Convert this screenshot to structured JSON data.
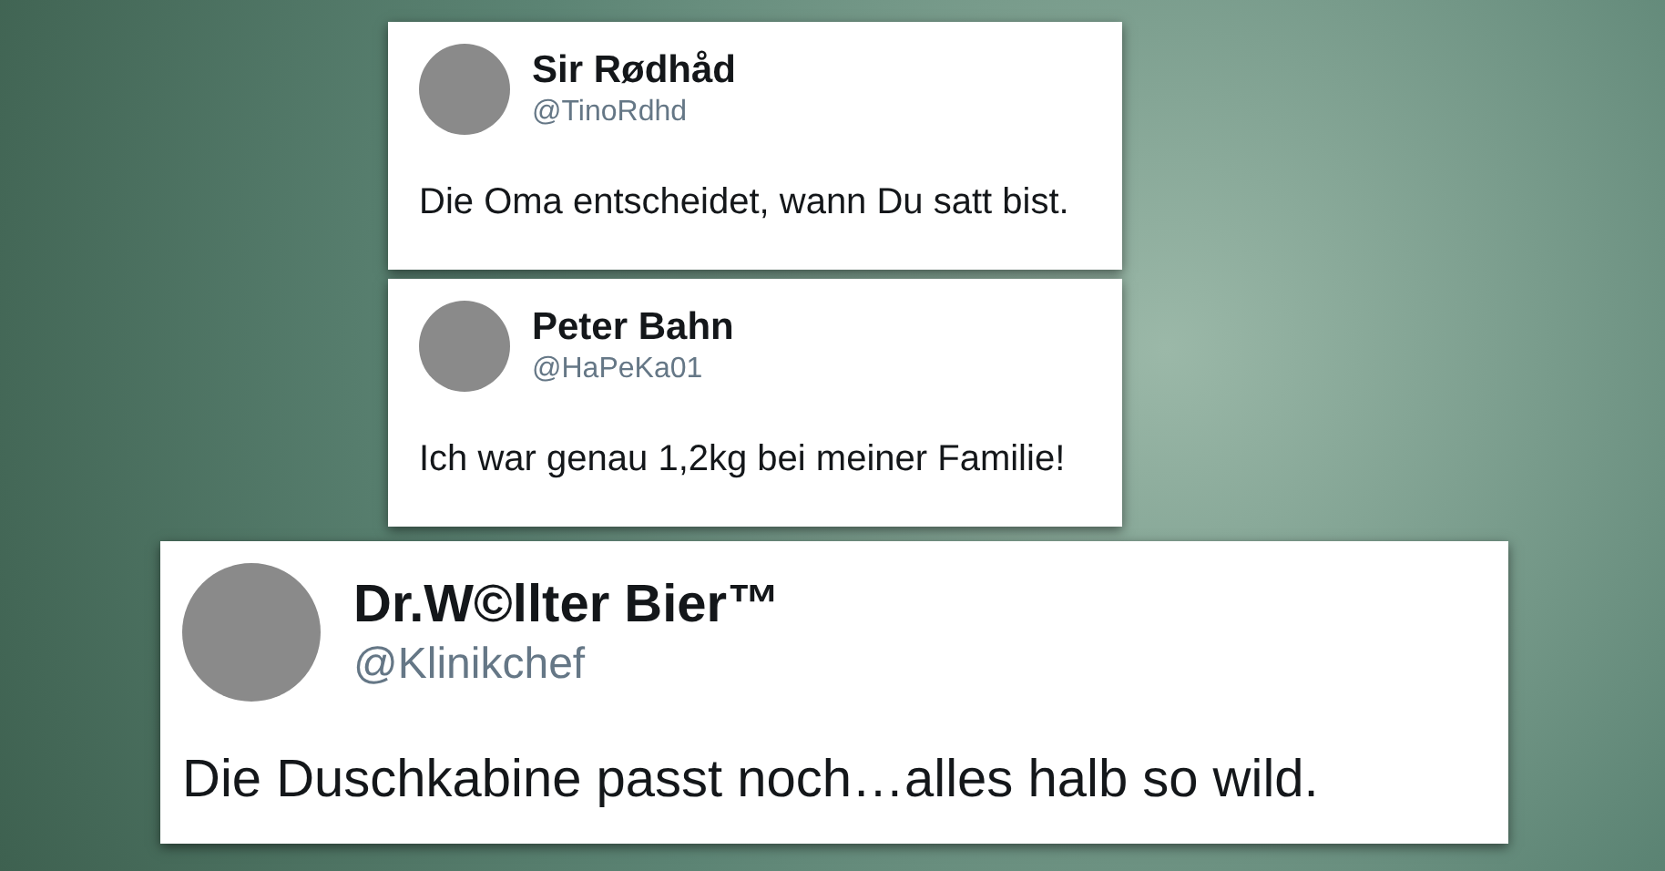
{
  "tweets": [
    {
      "name": "Sir Rødhåd",
      "handle": "@TinoRdhd",
      "text": "Die Oma entscheidet, wann Du satt bist.",
      "kind": "small"
    },
    {
      "name": "Peter Bahn",
      "handle": "@HaPeKa01",
      "text": "Ich war genau 1,2kg bei meiner Familie!",
      "kind": "small"
    },
    {
      "name": "Dr.W©llter Bier™",
      "handle": "@Klinikchef",
      "text": "Die Duschkabine passt noch…alles halb so wild.",
      "kind": "large"
    }
  ]
}
